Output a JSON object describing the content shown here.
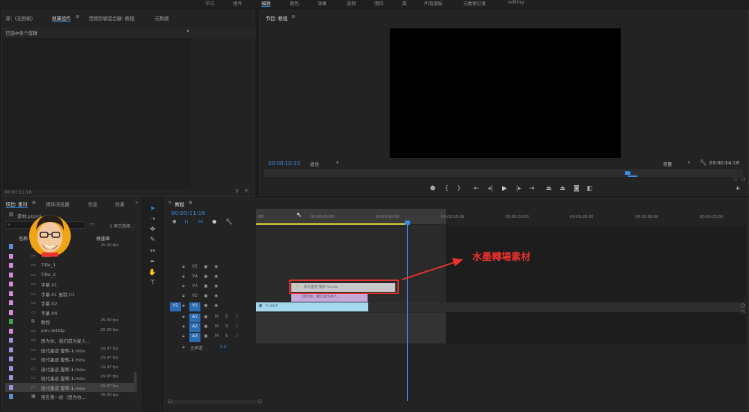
{
  "workspaces": [
    "学习",
    "组件",
    "编辑",
    "颜色",
    "效果",
    "音频",
    "图形",
    "库",
    "所有面板",
    "元数据记录",
    "editing"
  ],
  "source_panel": {
    "tabs": [
      "源：(无剪辑)",
      "效果控件",
      "音频剪辑混合器: 教程",
      "元数据"
    ],
    "selection_text": "已选中多个剪辑",
    "timecode": "00:00:11:16"
  },
  "program_monitor": {
    "title": "节目: 教程",
    "timecode": "00:00:10:20",
    "fit": "适合",
    "quality": "完整",
    "duration": "00:00:14:18",
    "controls": [
      "marker-icon",
      "in-icon",
      "out-icon",
      "go-in-icon",
      "step-back-icon",
      "play-icon",
      "step-forward-icon",
      "go-out-icon",
      "lift-icon",
      "extract-icon",
      "camera-icon",
      "compare-icon"
    ]
  },
  "project_panel": {
    "tabs": [
      "项目: 素材",
      "媒体浏览器",
      "信息",
      "效果"
    ],
    "project_file": "素材.prproj",
    "selection_count": "1 项已选择...",
    "col_name": "名称",
    "col_fps": "帧速率",
    "items": [
      {
        "name": "...管中国",
        "fps": "25.00 fps",
        "color": "#5d8fd6",
        "icon": "▣"
      },
      {
        "name": "Title",
        "fps": "",
        "color": "#d58ad8",
        "icon": ""
      },
      {
        "name": "Title_1",
        "fps": "",
        "color": "#d58ad8",
        "icon": ""
      },
      {
        "name": "Title_2",
        "fps": "",
        "color": "#d58ad8",
        "icon": ""
      },
      {
        "name": "字幕 01",
        "fps": "",
        "color": "#d58ad8",
        "icon": ""
      },
      {
        "name": "字幕 01 复制 01",
        "fps": "",
        "color": "#d58ad8",
        "icon": ""
      },
      {
        "name": "字幕 02",
        "fps": "",
        "color": "#d58ad8",
        "icon": ""
      },
      {
        "name": "字幕 04",
        "fps": "",
        "color": "#d58ad8",
        "icon": ""
      },
      {
        "name": "教程",
        "fps": "25.00 fps",
        "color": "#3fa34d",
        "icon": "⧉"
      },
      {
        "name": "sim.nbtitle",
        "fps": "25.00 fps",
        "color": "#d58ad8",
        "icon": ""
      },
      {
        "name": "因为你，我们成为家人...",
        "fps": "",
        "color": "#9f8fdc",
        "icon": ""
      },
      {
        "name": "现代墨迹 旋转-1.mov",
        "fps": "29.97 fps",
        "color": "#9f8fdc",
        "icon": ""
      },
      {
        "name": "现代墨迹 旋转-1.mov",
        "fps": "29.97 fps",
        "color": "#9f8fdc",
        "icon": ""
      },
      {
        "name": "现代墨迹 旋转-1.mov",
        "fps": "29.97 fps",
        "color": "#9f8fdc",
        "icon": ""
      },
      {
        "name": "现代墨迹 旋转-1.mov",
        "fps": "29.97 fps",
        "color": "#9f8fdc",
        "icon": ""
      },
      {
        "name": "现代墨迹 旋转-1.mov",
        "fps": "29.97 fps",
        "color": "#9f8fdc",
        "icon": ""
      },
      {
        "name": "预告第一段（因为你...",
        "fps": "25.00 fps",
        "color": "#5d8fd6",
        "icon": "▣"
      }
    ]
  },
  "timeline": {
    "title": "教程",
    "timecode": "00:00:11:16",
    "ticks": [
      ":00",
      "00:00:05:00",
      "00:00:10:00",
      "00:00:15:00",
      "00:00:20:00",
      "00:00:25:00",
      "00:00:30:00",
      "00:00:35:00"
    ],
    "video_tracks": [
      "V5",
      "V4",
      "V3",
      "V2",
      "V1"
    ],
    "audio_tracks": [
      "A1",
      "A2",
      "A3"
    ],
    "v1_source": "V1",
    "mix": {
      "label": "主声道",
      "value": "0.0"
    },
    "clips": {
      "v3": "现代墨迹 旋转-1.mov",
      "v2": "因为你，我们成为家人...",
      "v1": "fx.mp4"
    }
  },
  "annotation": {
    "label": "水墨轉場素材",
    "color": "#e8322b"
  },
  "colors": {
    "accent": "#2d8ceb",
    "playhead": "#3a8ee6",
    "selection": "#e8322b"
  }
}
